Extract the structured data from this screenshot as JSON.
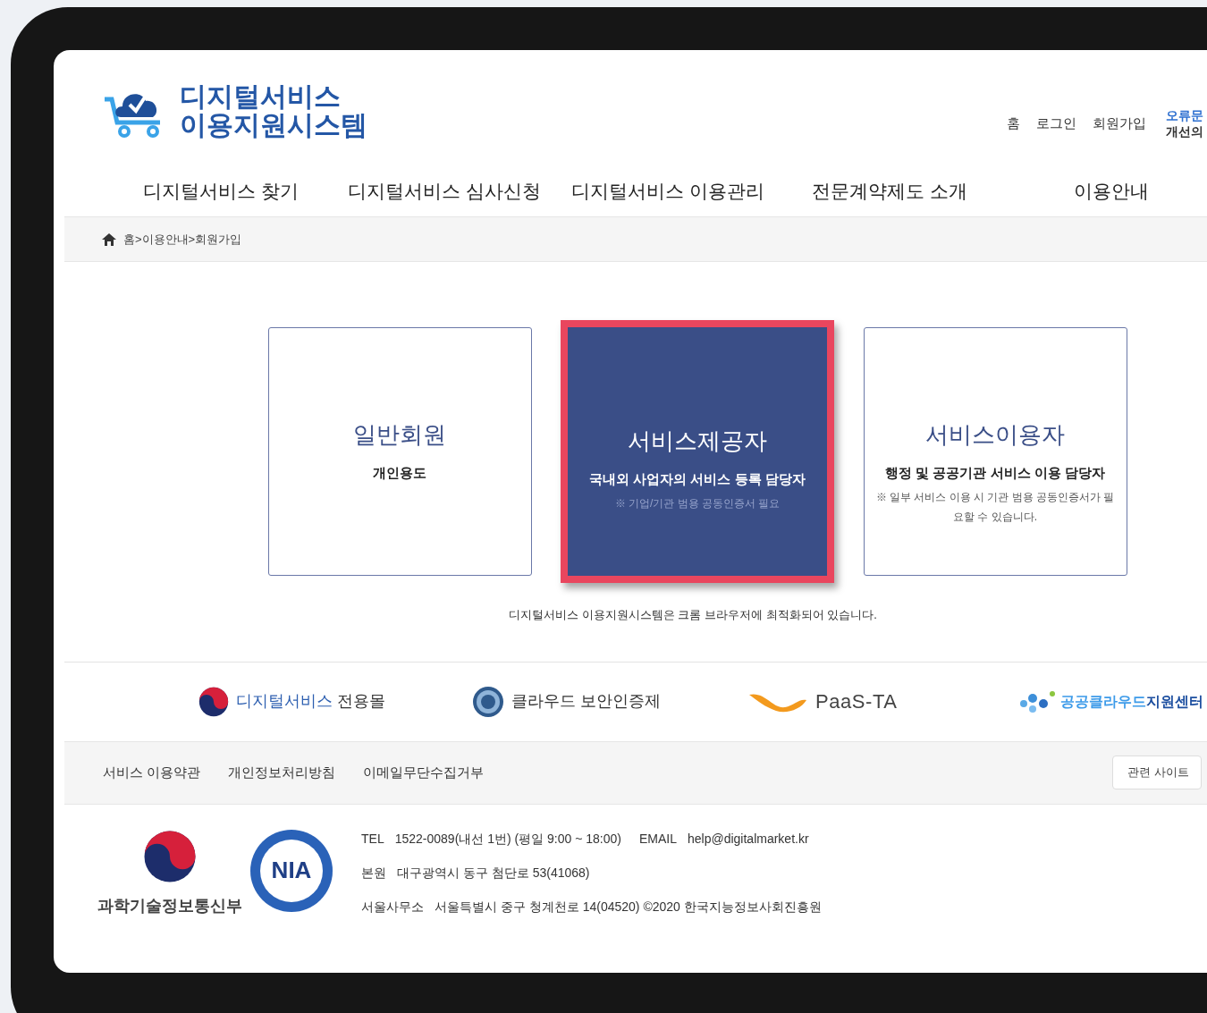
{
  "header": {
    "logo_lines": [
      "디지털서비스",
      "이용지원시스템"
    ],
    "top_links": [
      "홈",
      "로그인",
      "회원가입"
    ],
    "cut_link_lines": [
      "오류문",
      "개선의"
    ]
  },
  "main_nav": [
    "디지털서비스 찾기",
    "디지털서비스 심사신청",
    "디지털서비스 이용관리",
    "전문계약제도 소개",
    "이용안내"
  ],
  "breadcrumb": {
    "items": [
      "홈",
      "이용안내",
      "회원가입"
    ],
    "separator": ">"
  },
  "member_types": [
    {
      "title": "일반회원",
      "subtitle": "개인용도",
      "selected": false
    },
    {
      "title": "서비스제공자",
      "subtitle": "국내외 사업자의 서비스 등록 담당자",
      "note": "※ 기업/기관 범용 공동인증서 필요",
      "selected": true
    },
    {
      "title": "서비스이용자",
      "subtitle": "행정 및 공공기관 서비스 이용 담당자",
      "note": "※ 일부 서비스 이용 시 기관 범용 공동인증서가 필요할 수 있습니다.",
      "selected": false
    }
  ],
  "browser_note": "디지털서비스 이용지원시스템은 크롬 브라우저에 최적화되어 있습니다.",
  "partners": [
    {
      "kind": "mall",
      "parts": [
        "디지털서비스",
        "전용몰"
      ]
    },
    {
      "kind": "csap",
      "parts": [
        "클라우드 보안인증제"
      ]
    },
    {
      "kind": "paas",
      "parts": [
        "PaaS-TA"
      ]
    },
    {
      "kind": "center",
      "parts": [
        "공공클라우드",
        "지원센터"
      ]
    }
  ],
  "footer_links": [
    "서비스 이용약관",
    "개인정보처리방침",
    "이메일무단수집거부"
  ],
  "related_sites": "관련 사이트",
  "ministry_name": "과학기술정보통신부",
  "nia_logo": "NIA",
  "contact_lines": [
    [
      {
        "label": "TEL",
        "value": "1522-0089(내선 1번) (평일 9:00 ~ 18:00)"
      },
      {
        "label": "EMAIL",
        "value": "help@digitalmarket.kr"
      }
    ],
    [
      {
        "label": "본원",
        "value": "대구광역시 동구 첨단로 53(41068)"
      }
    ],
    [
      {
        "label": "서울사무소",
        "value": "서울특별시 중구 청계천로 14(04520) ©2020 한국지능정보사회진흥원"
      }
    ]
  ]
}
